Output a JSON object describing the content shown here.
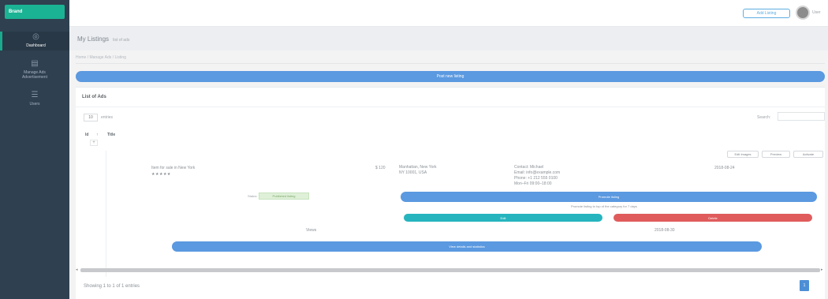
{
  "brand": {
    "label": "Brand"
  },
  "sidebar": {
    "items": [
      {
        "label": "Dashboard",
        "icon": "dashboard-icon"
      },
      {
        "label": "Manage Ads",
        "sub": "Advertisement",
        "icon": "ads-icon"
      },
      {
        "label": "Users",
        "icon": "users-icon"
      }
    ]
  },
  "topbar": {
    "pill": "Add Listing",
    "username": "User"
  },
  "heading": {
    "title": "My Listings",
    "subtitle": "list of ads"
  },
  "breadcrumb": "Home / Manage Ads / Listing",
  "post_button": "Post new listing",
  "panel": {
    "title": "List of Ads",
    "length_value": "10",
    "length_label": "entries",
    "search_label": "Search:",
    "columns": [
      "Id",
      "↑",
      "Title"
    ],
    "toggle": "+"
  },
  "row": {
    "actions": [
      "Edit Images",
      "Preview",
      "Activate"
    ],
    "title": "Item for sale in New York",
    "stars": "★★★★★",
    "price": "$ 120",
    "location": "Manhattan, New York",
    "location2": "NY 10001, USA",
    "contact": [
      "Contact: Michael",
      "Email: info@example.com",
      "Phone: +1 212 555 0100",
      "Mon–Fri 09:00–18:00"
    ],
    "date": "2018-08-24",
    "status_label": "Status:",
    "status": "Published listing",
    "promote": "Promote listing",
    "promote_note": "Promote listing to top of the category for 7 days",
    "edit": "Edit",
    "delete": "Delete",
    "views_label": "Views",
    "views_date": "2018-08-30",
    "details": "View details and statistics"
  },
  "footer": {
    "info": "Showing 1 to 1 of 1 entries",
    "page": "1"
  },
  "colors": {
    "sidebar": "#2f4050",
    "brand": "#1ab394",
    "primary": "#5b99e0",
    "teal": "#26b5be",
    "danger": "#e05c5c"
  }
}
